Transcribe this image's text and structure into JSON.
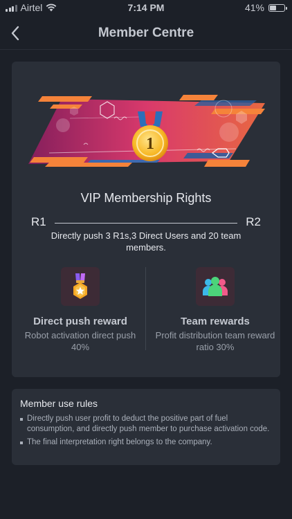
{
  "status_bar": {
    "carrier": "Airtel",
    "time": "7:14 PM",
    "battery": "41%"
  },
  "header": {
    "title": "Member Centre"
  },
  "membership": {
    "medal_number": "1",
    "title": "VIP Membership Rights",
    "current_level": "R1",
    "next_level": "R2",
    "requirement": "Directly push 3 R1s,3 Direct Users and 20 team members."
  },
  "rewards": [
    {
      "icon": "medal-star-icon",
      "title": "Direct push reward",
      "description": "Robot activation direct push 40%"
    },
    {
      "icon": "team-people-icon",
      "title": "Team rewards",
      "description": "Profit distribution team reward ratio 30%"
    }
  ],
  "rules": {
    "title": "Member use rules",
    "items": [
      "Directly push user profit to deduct the positive part of fuel consumption, and directly push member to purchase activation code.",
      "The final interpretation right belongs to the company."
    ]
  },
  "colors": {
    "background": "#1c2028",
    "card": "#2a2f38",
    "accent_orange": "#f5833a",
    "accent_pink": "#e8336a",
    "accent_blue": "#2d6fb8",
    "medal_gold": "#f7b825"
  }
}
